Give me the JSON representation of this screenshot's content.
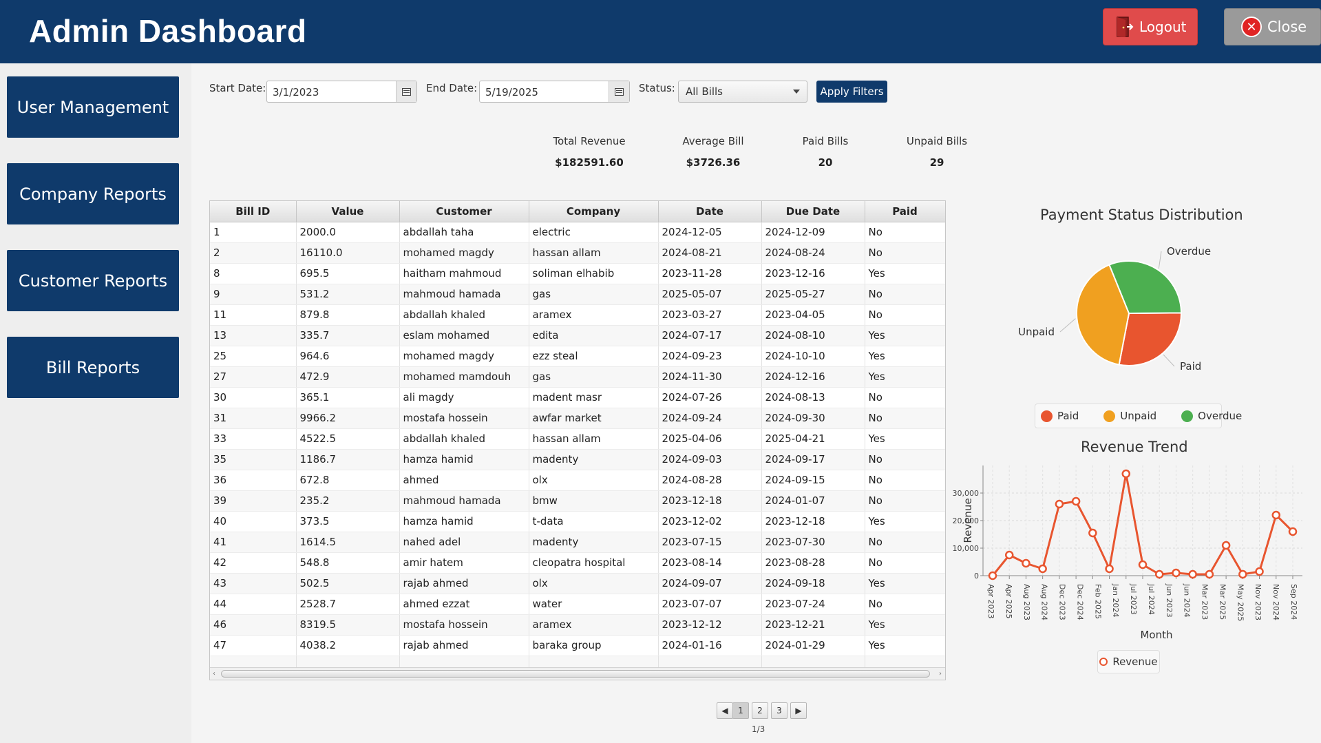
{
  "header": {
    "title": "Admin Dashboard",
    "logout_label": "Logout",
    "close_label": "Close"
  },
  "sidebar": {
    "items": [
      {
        "label": "User Management"
      },
      {
        "label": "Company Reports"
      },
      {
        "label": "Customer Reports"
      },
      {
        "label": "Bill Reports"
      }
    ]
  },
  "filters": {
    "start_label": "Start Date:",
    "start_value": "3/1/2023",
    "end_label": "End Date:",
    "end_value": "5/19/2025",
    "status_label": "Status:",
    "status_value": "All Bills",
    "apply_label": "Apply Filters"
  },
  "stats": [
    {
      "label": "Total Revenue",
      "value": "$182591.60"
    },
    {
      "label": "Average Bill",
      "value": "$3726.36"
    },
    {
      "label": "Paid Bills",
      "value": "20"
    },
    {
      "label": "Unpaid Bills",
      "value": "29"
    }
  ],
  "table": {
    "columns": [
      "Bill ID",
      "Value",
      "Customer",
      "Company",
      "Date",
      "Due Date",
      "Paid"
    ],
    "rows": [
      [
        "1",
        "2000.0",
        "abdallah taha",
        "electric",
        "2024-12-05",
        "2024-12-09",
        "No"
      ],
      [
        "2",
        "16110.0",
        "mohamed magdy",
        "hassan allam",
        "2024-08-21",
        "2024-08-24",
        "No"
      ],
      [
        "8",
        "695.5",
        "haitham mahmoud",
        "soliman elhabib",
        "2023-11-28",
        "2023-12-16",
        "Yes"
      ],
      [
        "9",
        "531.2",
        "mahmoud hamada",
        "gas",
        "2025-05-07",
        "2025-05-27",
        "No"
      ],
      [
        "11",
        "879.8",
        "abdallah khaled",
        "aramex",
        "2023-03-27",
        "2023-04-05",
        "No"
      ],
      [
        "13",
        "335.7",
        "eslam mohamed",
        "edita",
        "2024-07-17",
        "2024-08-10",
        "Yes"
      ],
      [
        "25",
        "964.6",
        "mohamed magdy",
        "ezz steal",
        "2024-09-23",
        "2024-10-10",
        "Yes"
      ],
      [
        "27",
        "472.9",
        "mohamed mamdouh",
        "gas",
        "2024-11-30",
        "2024-12-16",
        "Yes"
      ],
      [
        "30",
        "365.1",
        "ali magdy",
        "madent masr",
        "2024-07-26",
        "2024-08-13",
        "No"
      ],
      [
        "31",
        "9966.2",
        "mostafa hossein",
        "awfar market",
        "2024-09-24",
        "2024-09-30",
        "No"
      ],
      [
        "33",
        "4522.5",
        "abdallah khaled",
        "hassan allam",
        "2025-04-06",
        "2025-04-21",
        "Yes"
      ],
      [
        "35",
        "1186.7",
        "hamza hamid",
        "madenty",
        "2024-09-03",
        "2024-09-17",
        "No"
      ],
      [
        "36",
        "672.8",
        "ahmed",
        "olx",
        "2024-08-28",
        "2024-09-15",
        "No"
      ],
      [
        "39",
        "235.2",
        "mahmoud hamada",
        "bmw",
        "2023-12-18",
        "2024-01-07",
        "No"
      ],
      [
        "40",
        "373.5",
        "hamza hamid",
        "t-data",
        "2023-12-02",
        "2023-12-18",
        "Yes"
      ],
      [
        "41",
        "1614.5",
        "nahed adel",
        "madenty",
        "2023-07-15",
        "2023-07-30",
        "No"
      ],
      [
        "42",
        "548.8",
        "amir hatem",
        "cleopatra hospital",
        "2023-08-14",
        "2023-08-28",
        "No"
      ],
      [
        "43",
        "502.5",
        "rajab ahmed",
        "olx",
        "2024-09-07",
        "2024-09-18",
        "Yes"
      ],
      [
        "44",
        "2528.7",
        "ahmed ezzat",
        "water",
        "2023-07-07",
        "2023-07-24",
        "No"
      ],
      [
        "46",
        "8319.5",
        "mostafa hossein",
        "aramex",
        "2023-12-12",
        "2023-12-21",
        "Yes"
      ],
      [
        "47",
        "4038.2",
        "rajab ahmed",
        "baraka group",
        "2024-01-16",
        "2024-01-29",
        "Yes"
      ]
    ]
  },
  "pagination": {
    "prev_icon": "◀",
    "next_icon": "▶",
    "pages": [
      "1",
      "2",
      "3"
    ],
    "current": "1/3"
  },
  "chart_data": [
    {
      "type": "pie",
      "title": "Payment Status Distribution",
      "labels": [
        "Paid",
        "Unpaid",
        "Overdue"
      ],
      "values": [
        20,
        29,
        22
      ],
      "colors": [
        "#e8552f",
        "#f0a020",
        "#4caf50"
      ],
      "legend": "bottom"
    },
    {
      "type": "line",
      "title": "Revenue Trend",
      "xlabel": "Month",
      "ylabel": "Revenue",
      "ylim": [
        0,
        40000
      ],
      "yticks": [
        "0",
        "10,000",
        "20,000",
        "30,000"
      ],
      "grid": true,
      "legend": "bottom",
      "categories": [
        "Apr 2023",
        "Apr 2025",
        "Aug 2023",
        "Aug 2024",
        "Dec 2023",
        "Dec 2024",
        "Feb 2025",
        "Jan 2024",
        "Jul 2023",
        "Jul 2024",
        "Jun 2023",
        "Jun 2024",
        "Mar 2023",
        "Mar 2025",
        "May 2025",
        "Nov 2023",
        "Nov 2024",
        "Sep 2024"
      ],
      "series": [
        {
          "name": "Revenue",
          "color": "#e8552f",
          "values": [
            0,
            7500,
            4500,
            2500,
            26000,
            27000,
            15500,
            2500,
            37000,
            4000,
            500,
            1000,
            500,
            500,
            11000,
            500,
            1500,
            22000,
            16000
          ]
        }
      ]
    }
  ]
}
